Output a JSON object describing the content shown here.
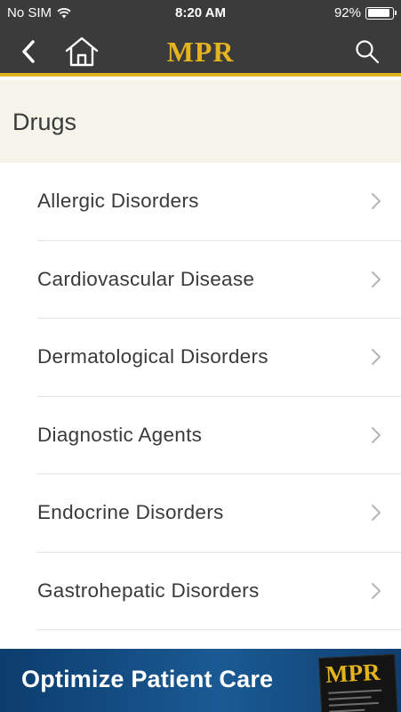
{
  "status_bar": {
    "carrier": "No SIM",
    "time": "8:20 AM",
    "battery_percent_label": "92%",
    "battery_level": 0.92
  },
  "nav": {
    "logo": "MPR",
    "accent_color": "#e3b41f",
    "bar_color": "#3b3b3b",
    "icons": [
      "chevron-left-icon",
      "home-icon",
      "search-icon"
    ]
  },
  "section": {
    "title": "Drugs"
  },
  "list": {
    "items": [
      {
        "label": "Allergic Disorders"
      },
      {
        "label": "Cardiovascular Disease"
      },
      {
        "label": "Dermatological Disorders"
      },
      {
        "label": "Diagnostic Agents"
      },
      {
        "label": "Endocrine Disorders"
      },
      {
        "label": "Gastrohepatic Disorders"
      }
    ]
  },
  "ad": {
    "text": "Optimize Patient Care",
    "cover_logo": "MPR"
  }
}
